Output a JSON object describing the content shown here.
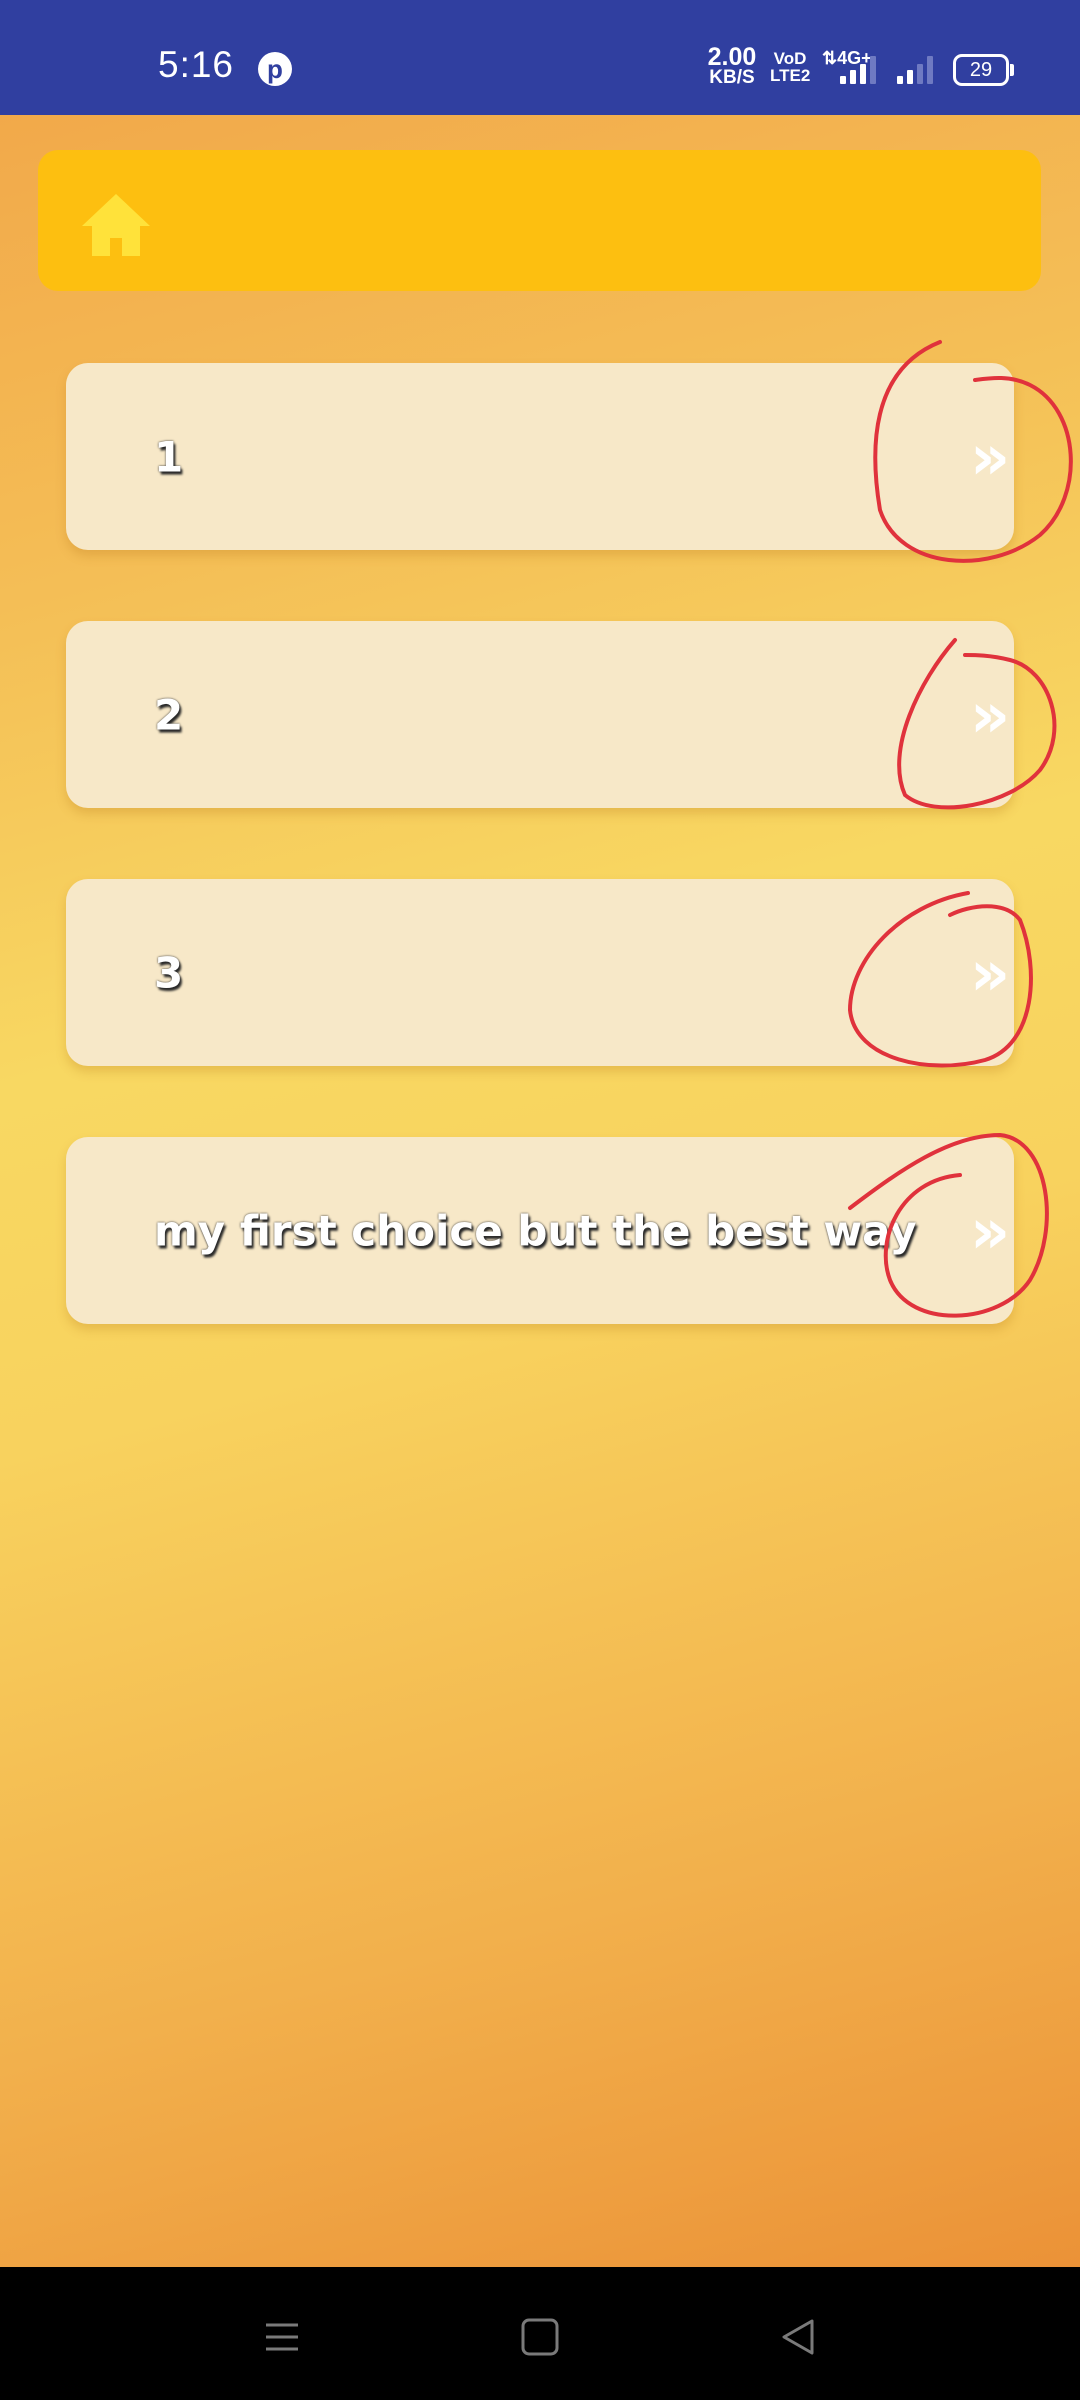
{
  "status_bar": {
    "time": "5:16",
    "notification_icon": "pinterest-icon",
    "net_speed_value": "2.00",
    "net_speed_unit": "KB/S",
    "volte_line1": "VoD",
    "volte_line2": "LTE2",
    "network_type": "4G+",
    "battery": "29"
  },
  "header": {
    "icon": "home-icon",
    "color": "#fdbf10"
  },
  "items": [
    {
      "label": "1",
      "chevron": "»"
    },
    {
      "label": "2",
      "chevron": "»"
    },
    {
      "label": "3",
      "chevron": "»"
    },
    {
      "label": "my first choice but the best way",
      "chevron": "»"
    }
  ],
  "annotation_color": "#e0323c",
  "nav_bar": {
    "icons": [
      "menu-icon",
      "home-square-icon",
      "back-triangle-icon"
    ]
  }
}
